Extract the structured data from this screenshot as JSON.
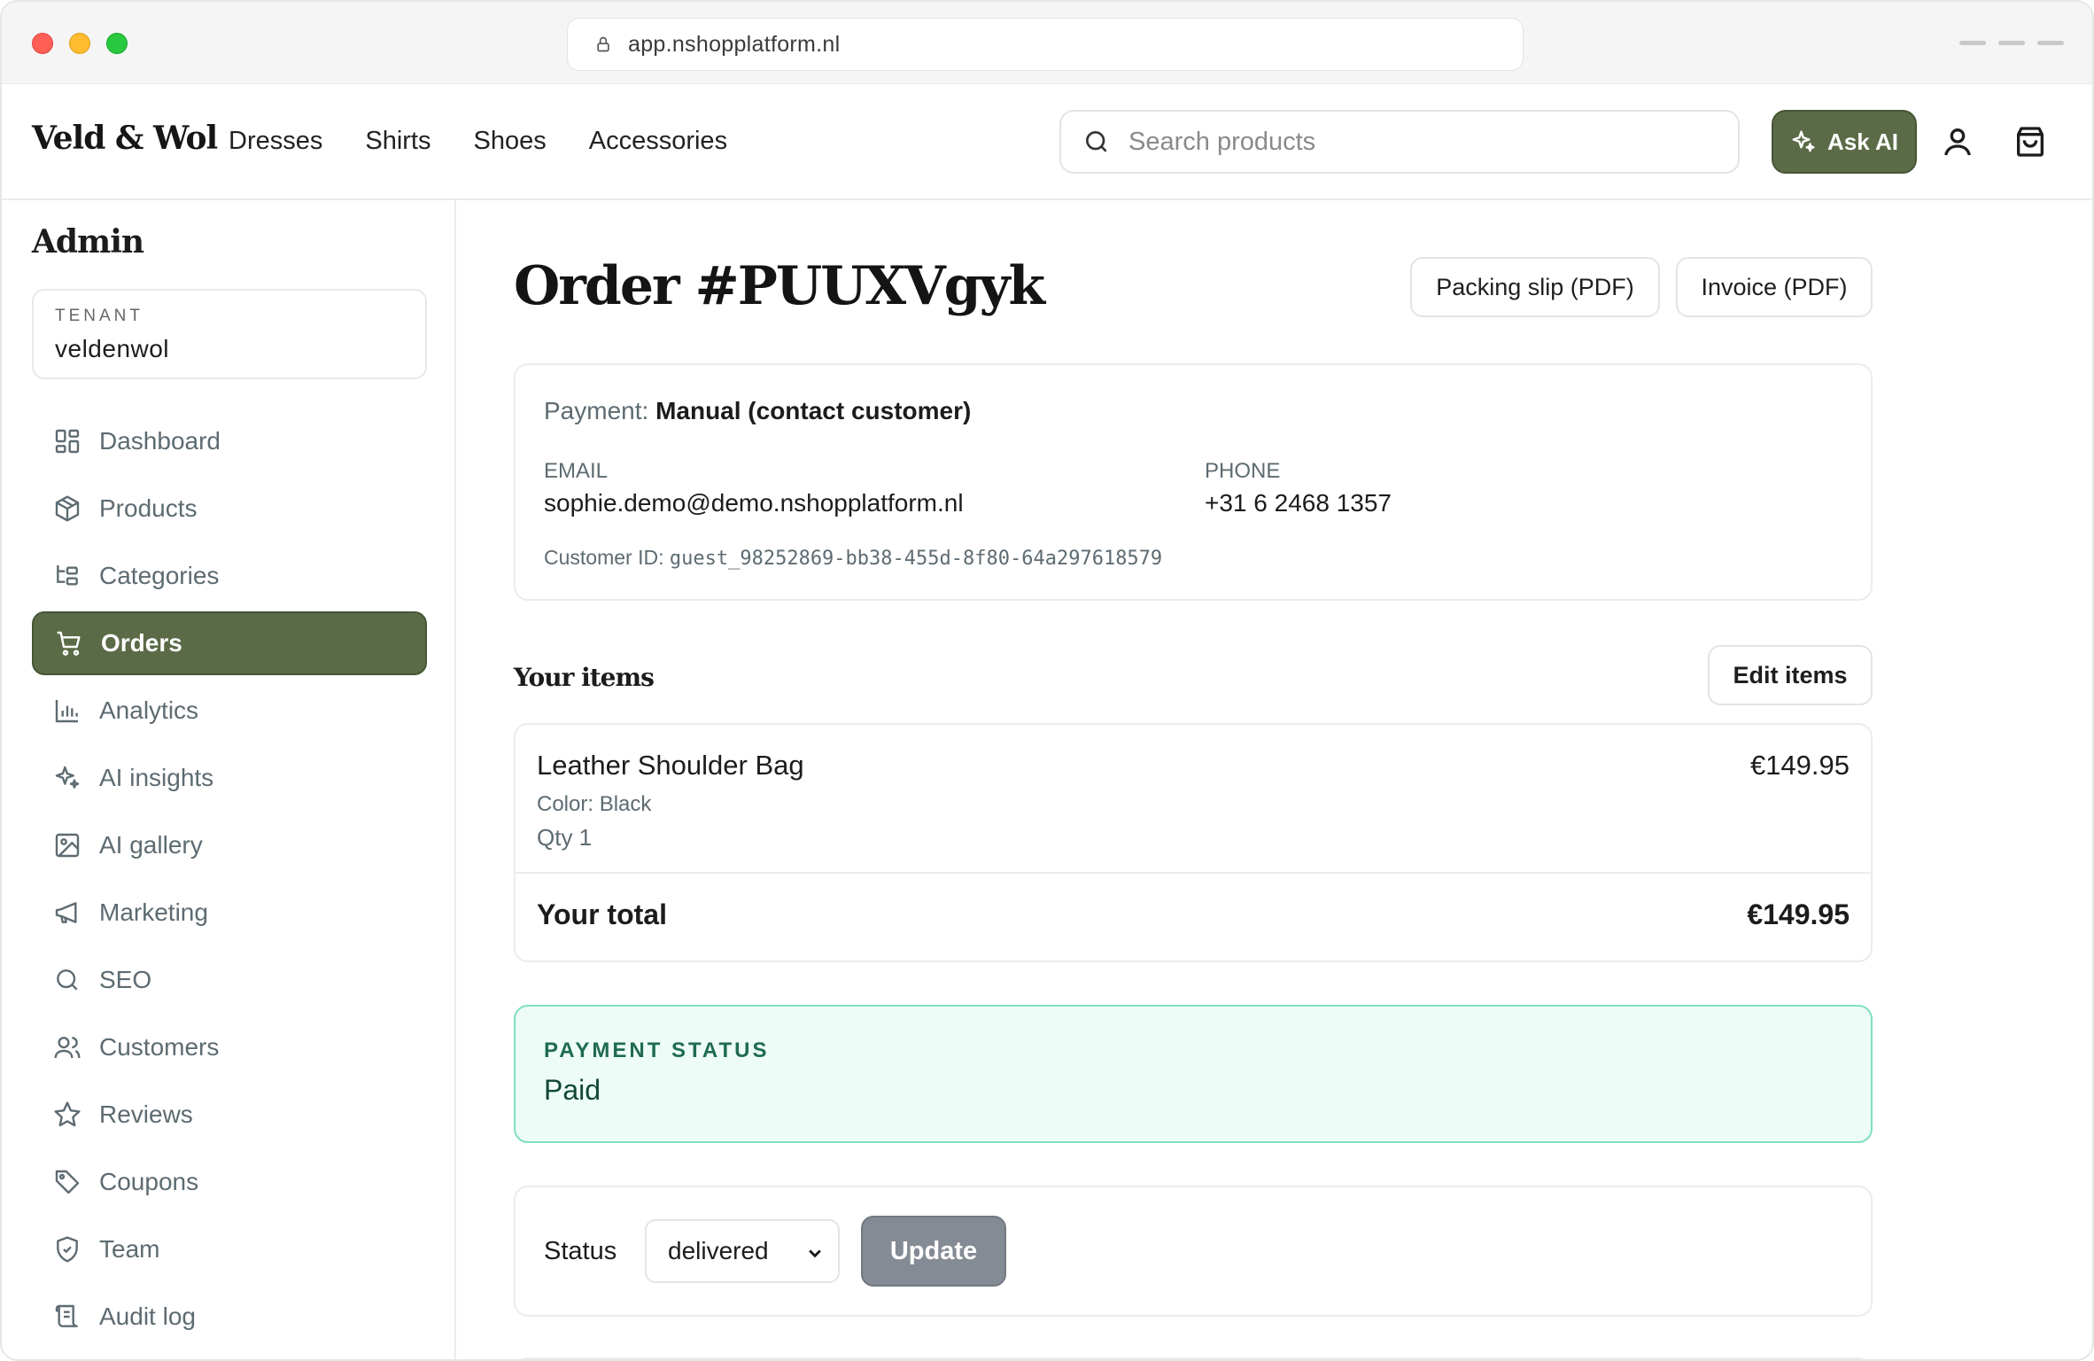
{
  "browser": {
    "url": "app.nshopplatform.nl"
  },
  "header": {
    "brand": "Veld & Wol",
    "nav": [
      "Dresses",
      "Shirts",
      "Shoes",
      "Accessories"
    ],
    "search_placeholder": "Search products",
    "ask_ai_label": "Ask AI"
  },
  "sidebar": {
    "title": "Admin",
    "tenant_label": "TENANT",
    "tenant_value": "veldenwol",
    "items": [
      {
        "label": "Dashboard",
        "icon": "dashboard-icon"
      },
      {
        "label": "Products",
        "icon": "box-icon"
      },
      {
        "label": "Categories",
        "icon": "tree-icon"
      },
      {
        "label": "Orders",
        "icon": "cart-icon",
        "active": true
      },
      {
        "label": "Analytics",
        "icon": "bar-chart-icon"
      },
      {
        "label": "AI insights",
        "icon": "sparkle-icon"
      },
      {
        "label": "AI gallery",
        "icon": "image-icon"
      },
      {
        "label": "Marketing",
        "icon": "megaphone-icon"
      },
      {
        "label": "SEO",
        "icon": "search-icon"
      },
      {
        "label": "Customers",
        "icon": "users-icon"
      },
      {
        "label": "Reviews",
        "icon": "star-icon"
      },
      {
        "label": "Coupons",
        "icon": "tag-icon"
      },
      {
        "label": "Team",
        "icon": "shield-icon"
      },
      {
        "label": "Audit log",
        "icon": "scroll-icon"
      }
    ]
  },
  "order": {
    "title": "Order #PUUXVgyk",
    "packing_slip_label": "Packing slip (PDF)",
    "invoice_label": "Invoice (PDF)",
    "payment_label": "Payment:",
    "payment_value": "Manual (contact customer)",
    "email_label": "EMAIL",
    "email_value": "sophie.demo@demo.nshopplatform.nl",
    "phone_label": "PHONE",
    "phone_value": "+31 6 2468 1357",
    "customer_id_label": "Customer ID:",
    "customer_id_value": "guest_98252869-bb38-455d-8f80-64a297618579",
    "items_heading": "Your items",
    "edit_items_label": "Edit items",
    "items": [
      {
        "name": "Leather Shoulder Bag",
        "price": "€149.95",
        "variant": "Color: Black",
        "qty": "Qty 1"
      }
    ],
    "total_label": "Your total",
    "total_value": "€149.95",
    "payment_status_label": "PAYMENT STATUS",
    "payment_status_value": "Paid",
    "status_label": "Status",
    "status_options": [
      "delivered"
    ],
    "update_label": "Update"
  },
  "colors": {
    "accent": "#5b6b47",
    "status_bg": "#edfcf6",
    "status_border": "#7fe0bf",
    "status_text": "#1f6b52",
    "update_button": "#858b94"
  }
}
